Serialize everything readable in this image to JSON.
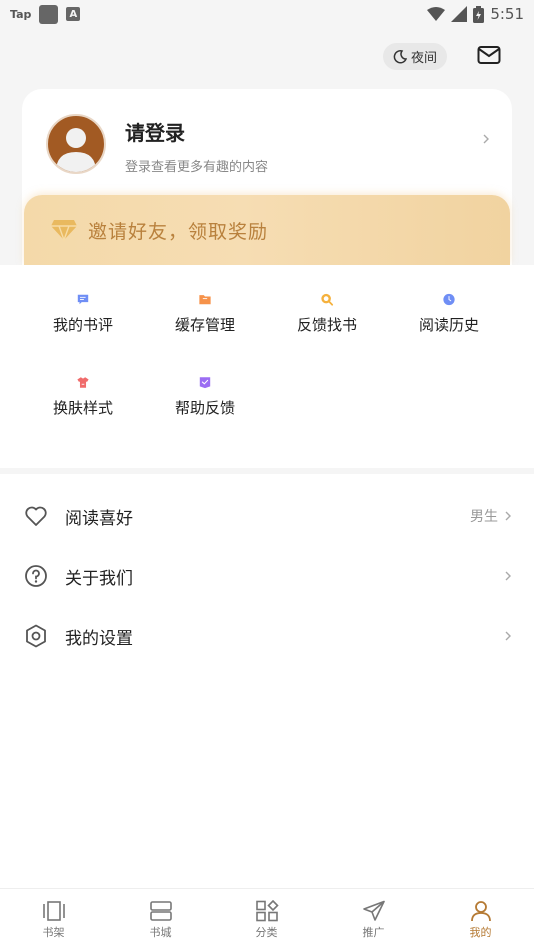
{
  "status_bar": {
    "left_app": "Tap",
    "left_icon": "A",
    "time": "5:51"
  },
  "header": {
    "night_label": "夜间"
  },
  "profile": {
    "title": "请登录",
    "subtitle": "登录查看更多有趣的内容"
  },
  "invite": {
    "text": "邀请好友，领取奖励"
  },
  "grid": {
    "items": [
      {
        "label": "我的书评",
        "icon": "comment-icon",
        "color": "#6f8ef5"
      },
      {
        "label": "缓存管理",
        "icon": "folder-icon",
        "color": "#f6924a"
      },
      {
        "label": "反馈找书",
        "icon": "search-book-icon",
        "color": "#f5b13d"
      },
      {
        "label": "阅读历史",
        "icon": "clock-icon",
        "color": "#6f8ef5"
      },
      {
        "label": "换肤样式",
        "icon": "shirt-icon",
        "color": "#f06b6b"
      },
      {
        "label": "帮助反馈",
        "icon": "help-check-icon",
        "color": "#9b6df3"
      }
    ]
  },
  "list": {
    "items": [
      {
        "label": "阅读喜好",
        "value": "男生",
        "icon": "heart-icon"
      },
      {
        "label": "关于我们",
        "value": "",
        "icon": "question-icon"
      },
      {
        "label": "我的设置",
        "value": "",
        "icon": "settings-icon"
      }
    ]
  },
  "tabs": [
    {
      "label": "书架",
      "icon": "bookshelf-icon"
    },
    {
      "label": "书城",
      "icon": "bookstore-icon"
    },
    {
      "label": "分类",
      "icon": "category-icon"
    },
    {
      "label": "推广",
      "icon": "send-icon"
    },
    {
      "label": "我的",
      "icon": "profile-icon",
      "active": true
    }
  ],
  "colors": {
    "accent": "#b57a34",
    "invite_text": "#b9813d",
    "banner_gold": "#f4d9a9"
  }
}
